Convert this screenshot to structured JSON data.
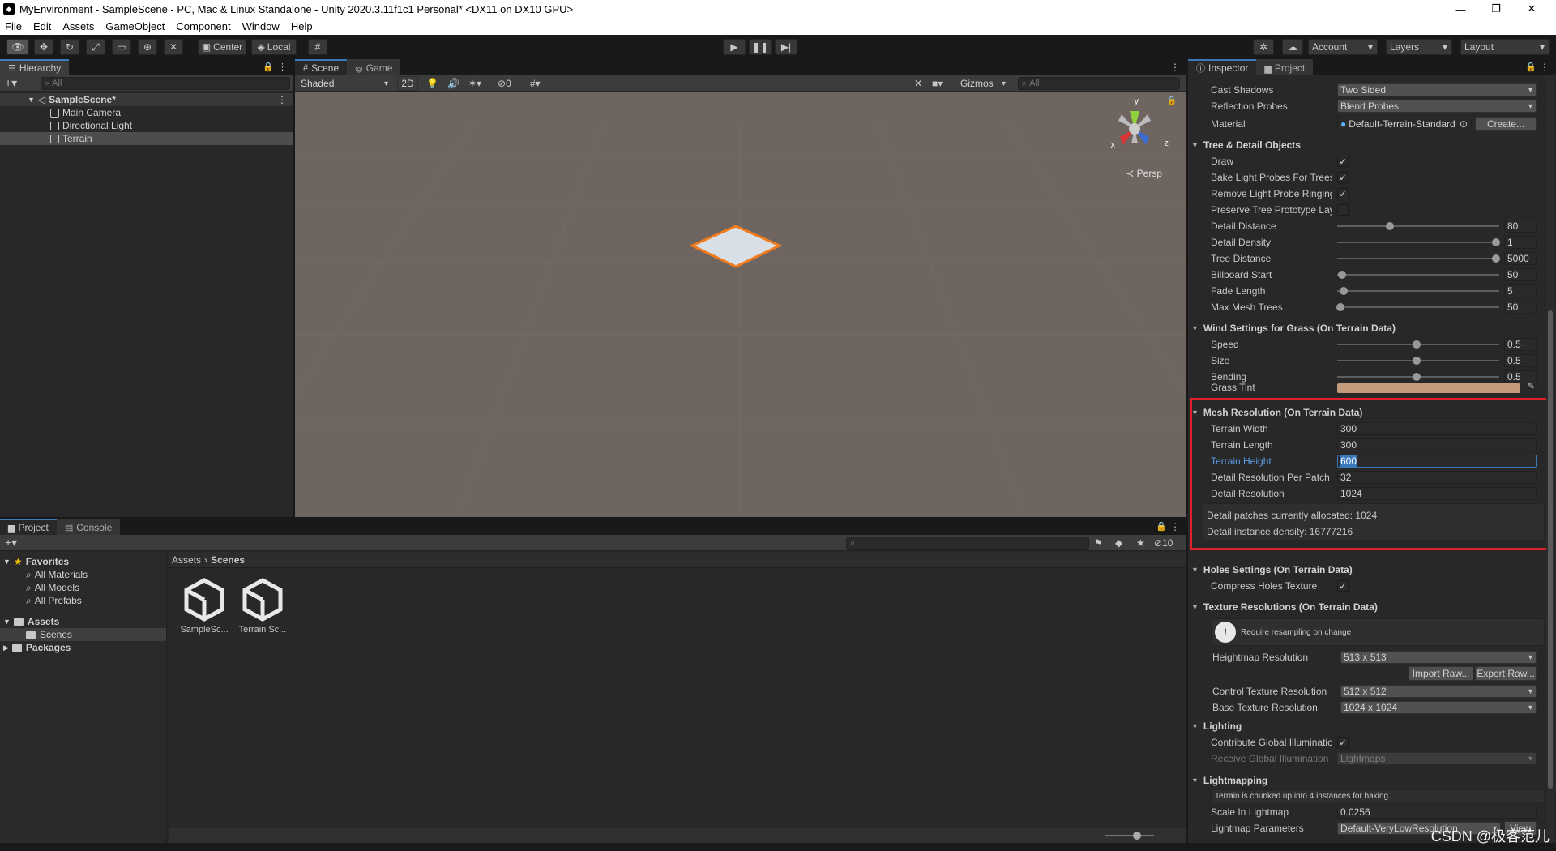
{
  "window": {
    "title": "MyEnvironment - SampleScene - PC, Mac & Linux Standalone - Unity 2020.3.11f1c1 Personal* <DX11 on DX10 GPU>",
    "minimize": "—",
    "maximize": "❐",
    "close": "✕"
  },
  "menu": [
    "File",
    "Edit",
    "Assets",
    "GameObject",
    "Component",
    "Window",
    "Help"
  ],
  "toolbar": {
    "center_label": "Center",
    "local_label": "Local",
    "account_label": "Account",
    "layers_label": "Layers",
    "layout_label": "Layout"
  },
  "hierarchy": {
    "tab_label": "Hierarchy",
    "search_placeholder": "All",
    "scene_name": "SampleScene*",
    "objects": [
      "Main Camera",
      "Directional Light",
      "Terrain"
    ],
    "selected": "Terrain"
  },
  "scene": {
    "tabs": [
      "Scene",
      "Game"
    ],
    "shading_mode": "Shaded",
    "mode_2d": "2D",
    "hidden_count": "0",
    "gizmos_label": "Gizmos",
    "search_placeholder": "All",
    "persp_label": "Persp",
    "gizmo_y": "y",
    "gizmo_x": "x",
    "gizmo_z": "z"
  },
  "project": {
    "tabs": [
      "Project",
      "Console"
    ],
    "favorites_label": "Favorites",
    "favorites": [
      "All Materials",
      "All Models",
      "All Prefabs"
    ],
    "assets_label": "Assets",
    "assets_children": [
      "Scenes"
    ],
    "packages_label": "Packages",
    "breadcrumb": [
      "Assets",
      "Scenes"
    ],
    "files": [
      "SampleSc...",
      "Terrain Sc..."
    ],
    "hidden_count": "10"
  },
  "inspector": {
    "tabs": [
      "Inspector",
      "Project"
    ],
    "top_rows": [
      {
        "label": "Cast Shadows",
        "value": "Two Sided"
      },
      {
        "label": "Reflection Probes",
        "value": "Blend Probes"
      }
    ],
    "material_label": "Material",
    "material_value": "Default-Terrain-Standard",
    "create_button": "Create...",
    "tree_section": "Tree & Detail Objects",
    "tree_checks": [
      {
        "label": "Draw",
        "checked": "✓"
      },
      {
        "label": "Bake Light Probes For Trees",
        "checked": "✓"
      },
      {
        "label": "Remove Light Probe Ringing",
        "checked": "✓"
      },
      {
        "label": "Preserve Tree Prototype Layers",
        "checked": ""
      }
    ],
    "tree_sliders": [
      {
        "label": "Detail Distance",
        "value": "80",
        "pos": 0.33
      },
      {
        "label": "Detail Density",
        "value": "1",
        "pos": 1.0
      },
      {
        "label": "Tree Distance",
        "value": "5000",
        "pos": 1.0
      },
      {
        "label": "Billboard Start",
        "value": "50",
        "pos": 0.03
      },
      {
        "label": "Fade Length",
        "value": "5",
        "pos": 0.04
      },
      {
        "label": "Max Mesh Trees",
        "value": "50",
        "pos": 0.02
      }
    ],
    "wind_section": "Wind Settings for Grass (On Terrain Data)",
    "wind_sliders": [
      {
        "label": "Speed",
        "value": "0.5",
        "pos": 0.5
      },
      {
        "label": "Size",
        "value": "0.5",
        "pos": 0.5
      },
      {
        "label": "Bending",
        "value": "0.5",
        "pos": 0.5
      }
    ],
    "grass_tint_label": "Grass Tint",
    "grass_tint_color": "#c49b7a",
    "mesh_section": "Mesh Resolution (On Terrain Data)",
    "mesh_rows": [
      {
        "label": "Terrain Width",
        "value": "300"
      },
      {
        "label": "Terrain Length",
        "value": "300"
      },
      {
        "label": "Terrain Height",
        "value": "600"
      },
      {
        "label": "Detail Resolution Per Patch",
        "value": "32"
      },
      {
        "label": "Detail Resolution",
        "value": "1024"
      }
    ],
    "mesh_info_1": "Detail patches currently allocated: 1024",
    "mesh_info_2": "Detail instance density: 16777216",
    "holes_section": "Holes Settings (On Terrain Data)",
    "compress_holes_label": "Compress Holes Texture",
    "compress_holes_checked": "✓",
    "texture_section": "Texture Resolutions (On Terrain Data)",
    "resample_warning": "Require resampling on change",
    "heightmap_label": "Heightmap Resolution",
    "heightmap_value": "513 x 513",
    "import_raw": "Import Raw...",
    "export_raw": "Export Raw...",
    "control_tex_label": "Control Texture Resolution",
    "control_tex_value": "512 x 512",
    "base_tex_label": "Base Texture Resolution",
    "base_tex_value": "1024 x 1024",
    "lighting_section": "Lighting",
    "contribute_gi_label": "Contribute Global Illumination",
    "contribute_gi_checked": "✓",
    "receive_gi_label": "Receive Global Illumination",
    "receive_gi_value": "Lightmaps",
    "lightmapping_section": "Lightmapping",
    "lightmap_note": "Terrain is chunked up into 4 instances for baking.",
    "scale_lightmap_label": "Scale In Lightmap",
    "scale_lightmap_value": "0.0256",
    "lightmap_params_label": "Lightmap Parameters",
    "lightmap_params_value": "Default-VeryLowResolution",
    "view_button": "View"
  },
  "watermark": "CSDN @极客范儿",
  "colors": {
    "highlight_red": "#e0202a",
    "selection_blue": "#3a79bb",
    "active_label_blue": "#5c9ce6"
  }
}
